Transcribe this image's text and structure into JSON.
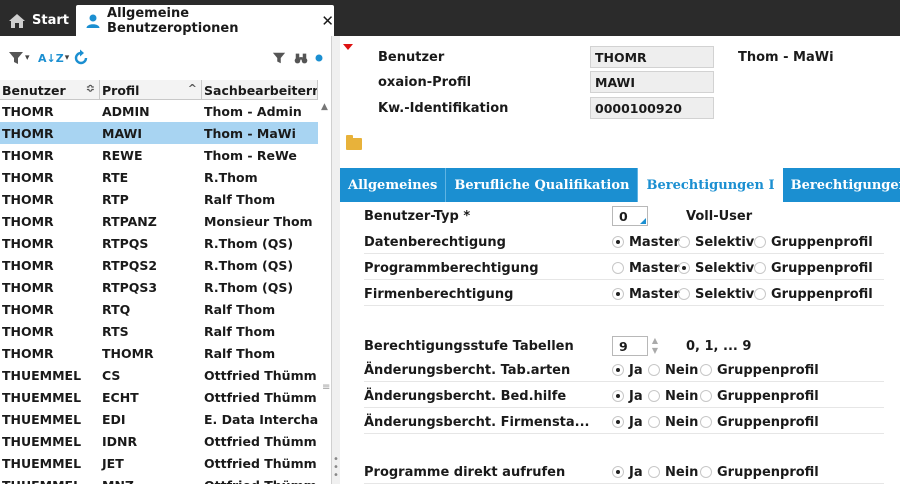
{
  "tabs": {
    "start_label": "Start",
    "active_label": "Allgemeine Benutzeroptionen",
    "close_glyph": "✕"
  },
  "left_toolbar": {
    "sort_label": "A↓Z"
  },
  "grid": {
    "columns": [
      "Benutzer",
      "Profil",
      "Sachbearbeitern"
    ],
    "rows": [
      [
        "THOMR",
        "ADMIN",
        "Thom - Admin"
      ],
      [
        "THOMR",
        "MAWI",
        "Thom - MaWi"
      ],
      [
        "THOMR",
        "REWE",
        "Thom - ReWe"
      ],
      [
        "THOMR",
        "RTE",
        "R.Thom"
      ],
      [
        "THOMR",
        "RTP",
        "Ralf Thom"
      ],
      [
        "THOMR",
        "RTPANZ",
        "Monsieur Thom"
      ],
      [
        "THOMR",
        "RTPQS",
        "R.Thom (QS)"
      ],
      [
        "THOMR",
        "RTPQS2",
        "R.Thom (QS)"
      ],
      [
        "THOMR",
        "RTPQS3",
        "R.Thom (QS)"
      ],
      [
        "THOMR",
        "RTQ",
        "Ralf Thom"
      ],
      [
        "THOMR",
        "RTS",
        "Ralf Thom"
      ],
      [
        "THOMR",
        "THOMR",
        "Ralf Thom"
      ],
      [
        "THUEMMEL",
        "CS",
        "Ottfried Thümm"
      ],
      [
        "THUEMMEL",
        "ECHT",
        "Ottfried Thümm"
      ],
      [
        "THUEMMEL",
        "EDI",
        "E. Data Interchange"
      ],
      [
        "THUEMMEL",
        "IDNR",
        "Ottfried Thümm"
      ],
      [
        "THUEMMEL",
        "JET",
        "Ottfried Thümm"
      ],
      [
        "THUEMMEL",
        "MNZ",
        "Ottfried Thümm"
      ]
    ],
    "selected_row": 1
  },
  "header": {
    "benutzer_label": "Benutzer",
    "benutzer_value": "THOMR",
    "benutzer_name": "Thom - MaWi",
    "profil_label": "oxaion-Profil",
    "profil_value": "MAWI",
    "kw_label": "Kw.-Identifikation",
    "kw_value": "0000100920"
  },
  "section_tabs": [
    "Allgemeines",
    "Berufliche Qualifikation",
    "Berechtigungen I",
    "Berechtigungen II"
  ],
  "active_section_tab": 2,
  "form": {
    "benutzer_typ_label": "Benutzer-Typ *",
    "benutzer_typ_value": "0",
    "benutzer_typ_text": "Voll-User",
    "datenberechtigung_label": "Datenberechtigung",
    "programmberechtigung_label": "Programmberechtigung",
    "firmenberechtigung_label": "Firmenberechtigung",
    "opt_master": "Master",
    "opt_selektiv": "Selektiv",
    "opt_gruppenprofil": "Gruppenprofil",
    "stufe_label": "Berechtigungsstufe Tabellen",
    "stufe_value": "9",
    "stufe_hint": "0, 1, ... 9",
    "aend_tab_label": "Änderungsbercht. Tab.arten",
    "aend_bed_label": "Änderungsbercht. Bed.hilfe",
    "aend_firm_label": "Änderungsbercht. Firmensta...",
    "prog_label": "Programme direkt aufrufen",
    "opt_ja": "Ja",
    "opt_nein": "Nein",
    "selected": {
      "datenberechtigung": "Master",
      "programmberechtigung": "Selektiv",
      "firmenberechtigung": "Master",
      "aend_tab": "Ja",
      "aend_bed": "Ja",
      "aend_firm": "Ja",
      "prog": "Ja"
    }
  },
  "colors": {
    "tab_blue": "#1b8fd1",
    "selection": "#a8d4f2",
    "topbar": "#2b2b2b"
  }
}
